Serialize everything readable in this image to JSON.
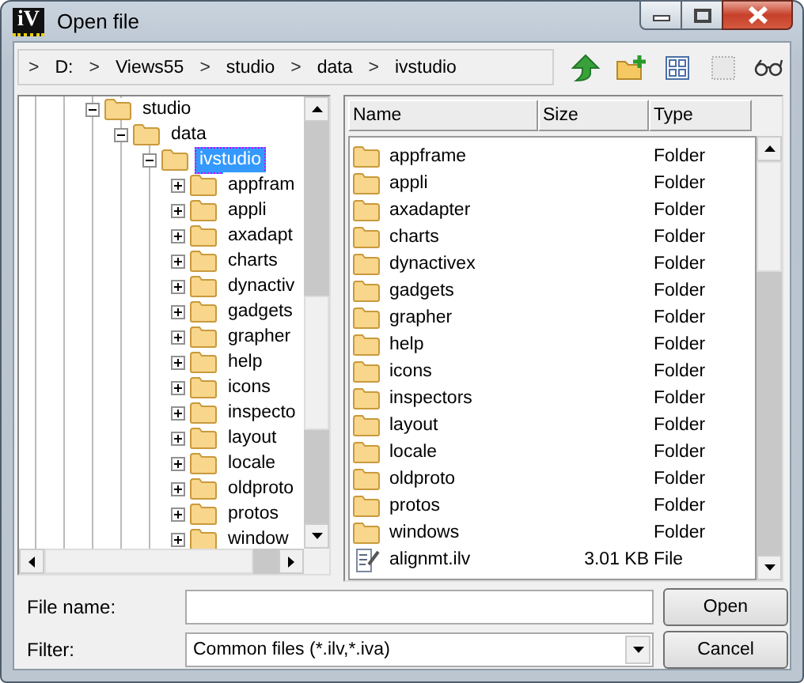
{
  "window": {
    "title": "Open file",
    "icon_label": "iV"
  },
  "breadcrumb": {
    "separator": ">",
    "items": [
      {
        "label": "D:"
      },
      {
        "label": "Views55"
      },
      {
        "label": "studio"
      },
      {
        "label": "data"
      },
      {
        "label": "ivstudio"
      }
    ]
  },
  "toolbar": [
    {
      "kind": "up",
      "disabled": false
    },
    {
      "kind": "new-folder",
      "disabled": false
    },
    {
      "kind": "icons",
      "disabled": false
    },
    {
      "kind": "details",
      "disabled": true
    },
    {
      "kind": "preview",
      "disabled": false
    }
  ],
  "tree": {
    "items": [
      {
        "label": "studio",
        "expanded": true,
        "selected": false,
        "children": [
          {
            "label": "data",
            "expanded": true,
            "selected": false,
            "children": [
              {
                "label": "ivstudio",
                "expanded": true,
                "selected": true,
                "children": [
                  {
                    "label": "appfram",
                    "expanded": false,
                    "selected": false
                  },
                  {
                    "label": "appli",
                    "expanded": false,
                    "selected": false
                  },
                  {
                    "label": "axadapt",
                    "expanded": false,
                    "selected": false
                  },
                  {
                    "label": "charts",
                    "expanded": false,
                    "selected": false
                  },
                  {
                    "label": "dynactiv",
                    "expanded": false,
                    "selected": false
                  },
                  {
                    "label": "gadgets",
                    "expanded": false,
                    "selected": false
                  },
                  {
                    "label": "grapher",
                    "expanded": false,
                    "selected": false
                  },
                  {
                    "label": "help",
                    "expanded": false,
                    "selected": false
                  },
                  {
                    "label": "icons",
                    "expanded": false,
                    "selected": false
                  },
                  {
                    "label": "inspecto",
                    "expanded": false,
                    "selected": false
                  },
                  {
                    "label": "layout",
                    "expanded": false,
                    "selected": false
                  },
                  {
                    "label": "locale",
                    "expanded": false,
                    "selected": false
                  },
                  {
                    "label": "oldproto",
                    "expanded": false,
                    "selected": false
                  },
                  {
                    "label": "protos",
                    "expanded": false,
                    "selected": false
                  },
                  {
                    "label": "window",
                    "expanded": false,
                    "selected": false
                  }
                ]
              }
            ]
          }
        ]
      }
    ]
  },
  "list": {
    "columns": [
      "Name",
      "Size",
      "Type"
    ],
    "rows": [
      {
        "kind": "folder",
        "name": "appframe",
        "type": "Folder"
      },
      {
        "kind": "folder",
        "name": "appli",
        "type": "Folder"
      },
      {
        "kind": "folder",
        "name": "axadapter",
        "type": "Folder"
      },
      {
        "kind": "folder",
        "name": "charts",
        "type": "Folder"
      },
      {
        "kind": "folder",
        "name": "dynactivex",
        "type": "Folder"
      },
      {
        "kind": "folder",
        "name": "gadgets",
        "type": "Folder"
      },
      {
        "kind": "folder",
        "name": "grapher",
        "type": "Folder"
      },
      {
        "kind": "folder",
        "name": "help",
        "type": "Folder"
      },
      {
        "kind": "folder",
        "name": "icons",
        "type": "Folder"
      },
      {
        "kind": "folder",
        "name": "inspectors",
        "type": "Folder"
      },
      {
        "kind": "folder",
        "name": "layout",
        "type": "Folder"
      },
      {
        "kind": "folder",
        "name": "locale",
        "type": "Folder"
      },
      {
        "kind": "folder",
        "name": "oldproto",
        "type": "Folder"
      },
      {
        "kind": "folder",
        "name": "protos",
        "type": "Folder"
      },
      {
        "kind": "folder",
        "name": "windows",
        "type": "Folder"
      },
      {
        "kind": "file",
        "name": "alignmt.ilv",
        "size": "3.01 KB",
        "type": "File"
      }
    ]
  },
  "file_name": {
    "label": "File name:"
  },
  "filter": {
    "label": "Filter:",
    "value": "Common files (*.ilv,*.iva)"
  },
  "buttons": [
    "Open",
    "Cancel"
  ]
}
